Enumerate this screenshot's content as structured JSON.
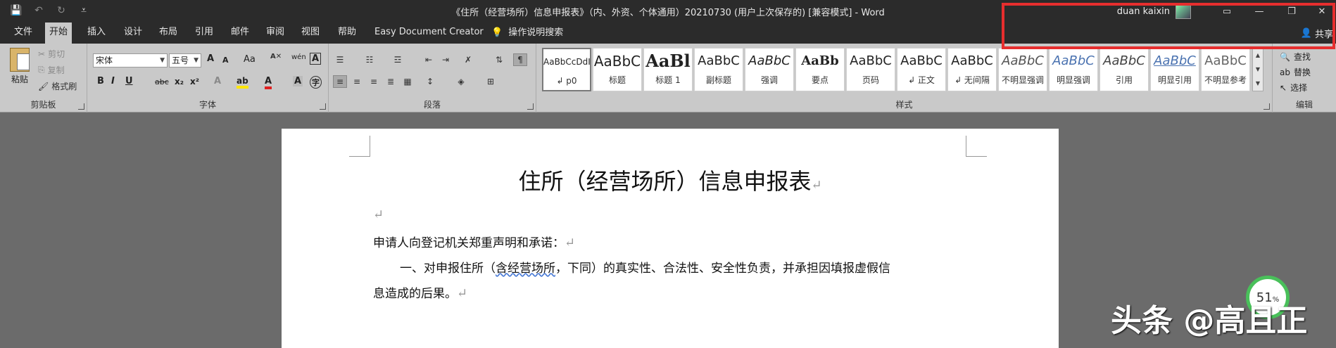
{
  "app": {
    "window_title": "《住所（经营场所）信息申报表》（内、外资、个体通用）20210730 (用户上次保存的) [兼容模式]  -  Word",
    "user_name": "duan kaixin",
    "share_label": "共享"
  },
  "qat": {
    "save": "💾",
    "undo": "↶",
    "redo": "↻",
    "customize": "⩡"
  },
  "tabs": [
    "文件",
    "开始",
    "插入",
    "设计",
    "布局",
    "引用",
    "邮件",
    "审阅",
    "视图",
    "帮助",
    "Easy Document Creator"
  ],
  "tell_me": "操作说明搜索",
  "clipboard": {
    "label": "剪贴板",
    "paste": "粘贴",
    "cut": "剪切",
    "copy": "复制",
    "format_painter": "格式刷"
  },
  "font": {
    "label": "字体",
    "name": "宋体",
    "size": "五号",
    "bold": "B",
    "italic": "I",
    "underline": "U",
    "strike": "abc",
    "sub": "x₂",
    "sup": "x²",
    "grow": "A",
    "shrink": "A",
    "case": "Aa",
    "wen": "wén",
    "border": "A",
    "effects": "A",
    "highlight": "ab",
    "color": "A",
    "shade": "A",
    "circle": "字"
  },
  "paragraph": {
    "label": "段落"
  },
  "styles": {
    "label": "样式",
    "items": [
      {
        "preview": "AaBbCcDdI",
        "name": "↲ p0",
        "selected": true
      },
      {
        "preview": "AaBbC",
        "name": "标题"
      },
      {
        "preview": "AaBl",
        "name": "标题 1"
      },
      {
        "preview": "AaBbC",
        "name": "副标题"
      },
      {
        "preview": "AaBbC",
        "name": "强调"
      },
      {
        "preview": "AaBb",
        "name": "要点"
      },
      {
        "preview": "AaBbC",
        "name": "页码"
      },
      {
        "preview": "AaBbC",
        "name": "↲ 正文"
      },
      {
        "preview": "AaBbC",
        "name": "↲ 无间隔"
      },
      {
        "preview": "AaBbC",
        "name": "不明显强调"
      },
      {
        "preview": "AaBbC",
        "name": "明显强调"
      },
      {
        "preview": "AaBbC",
        "name": "引用"
      },
      {
        "preview": "AaBbC",
        "name": "明显引用"
      },
      {
        "preview": "AaBbC",
        "name": "不明显参考"
      }
    ]
  },
  "editing": {
    "label": "编辑",
    "find": "查找",
    "replace": "替换",
    "select": "选择"
  },
  "document": {
    "title": "住所（经营场所）信息申报表",
    "para_mark": "↵",
    "line1": "申请人向登记机关郑重声明和承诺：",
    "line2_prefix": "一、对申报住所（",
    "line2_wavy": "含经营场所",
    "line2_suffix": "，下同）的真实性、合法性、安全性负责，并承担因填报虚假信",
    "line3": "息造成的后果。"
  },
  "overlay": {
    "progress_value": "51",
    "progress_unit": "%",
    "watermark": "头条 @高且正"
  }
}
